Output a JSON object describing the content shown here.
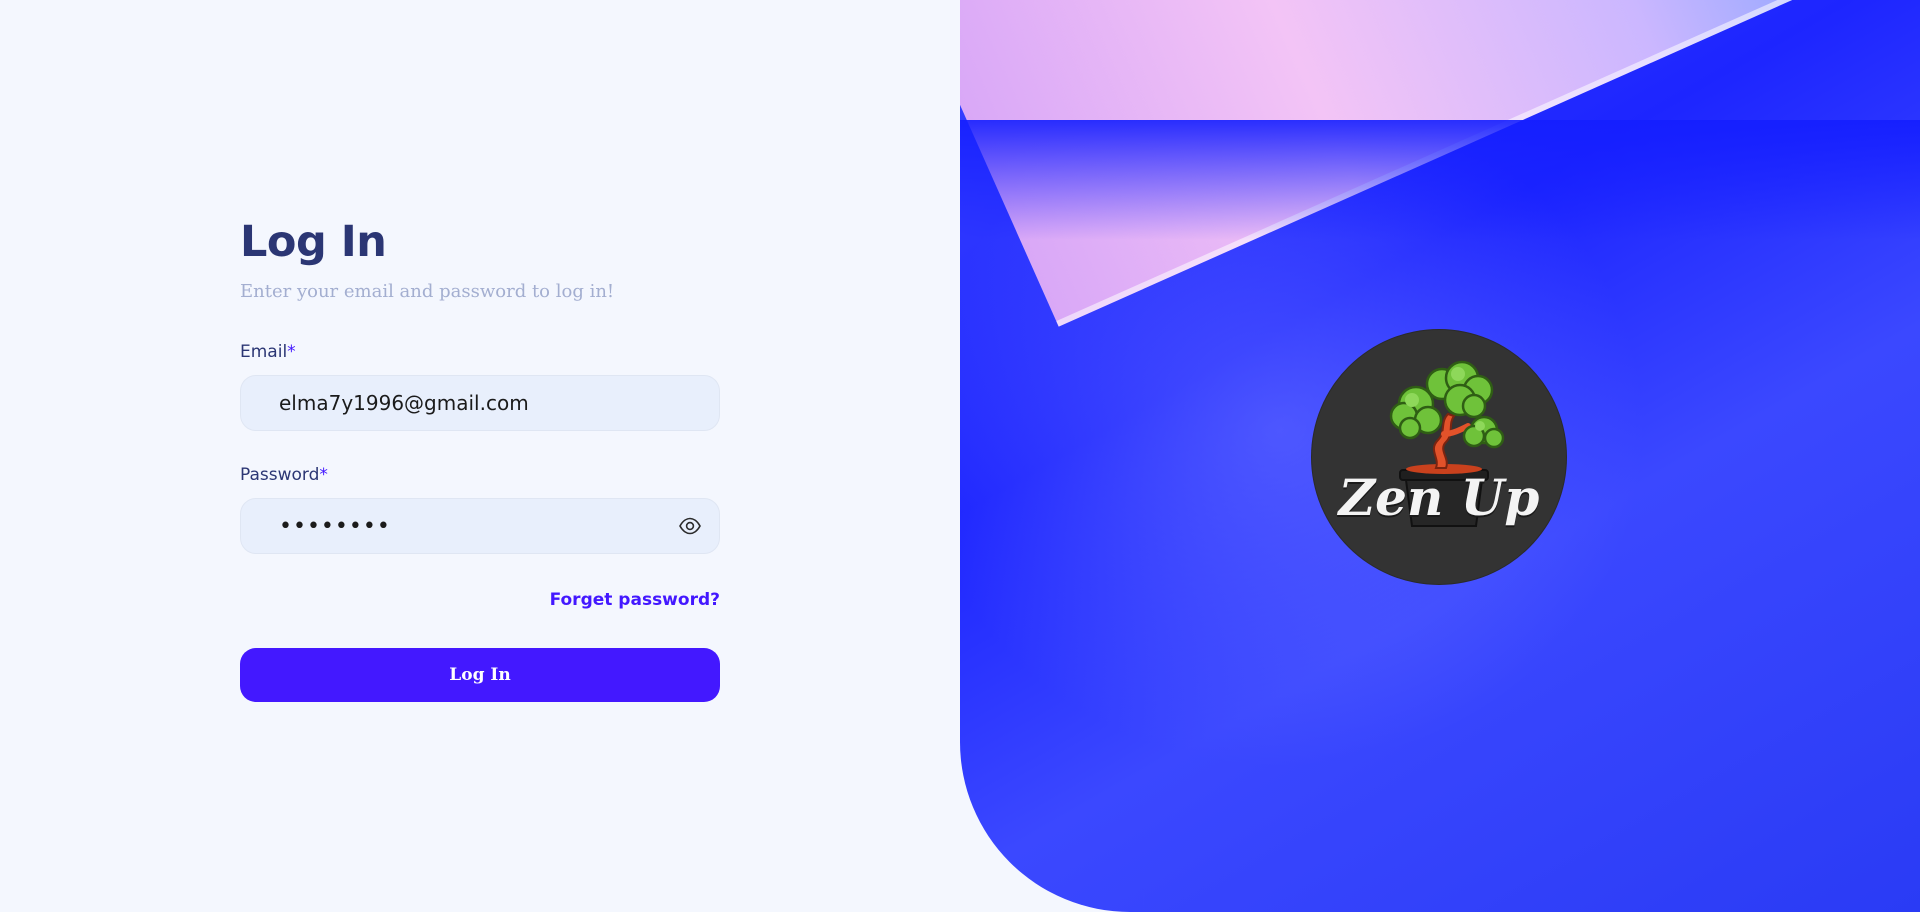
{
  "login": {
    "title": "Log In",
    "subtitle": "Enter your email and password to log in!",
    "email_label": "Email",
    "email_required": "*",
    "email_value": "elma7y1996@gmail.com",
    "password_label": "Password",
    "password_required": "*",
    "password_value": "••••••••",
    "forgot_link": "Forget password?",
    "submit_label": "Log In"
  },
  "brand": {
    "logo_text": "Zen Up",
    "logo_icon": "bonsai-tree-icon"
  },
  "icons": {
    "password_toggle": "eye-icon"
  },
  "colors": {
    "primary": "#4318ff",
    "heading": "#2b3674",
    "muted": "#a3aed0",
    "background": "#f4f7fe",
    "input_bg": "#e8effc",
    "hero_blue": "#1d25ff",
    "logo_bg": "#333333"
  }
}
